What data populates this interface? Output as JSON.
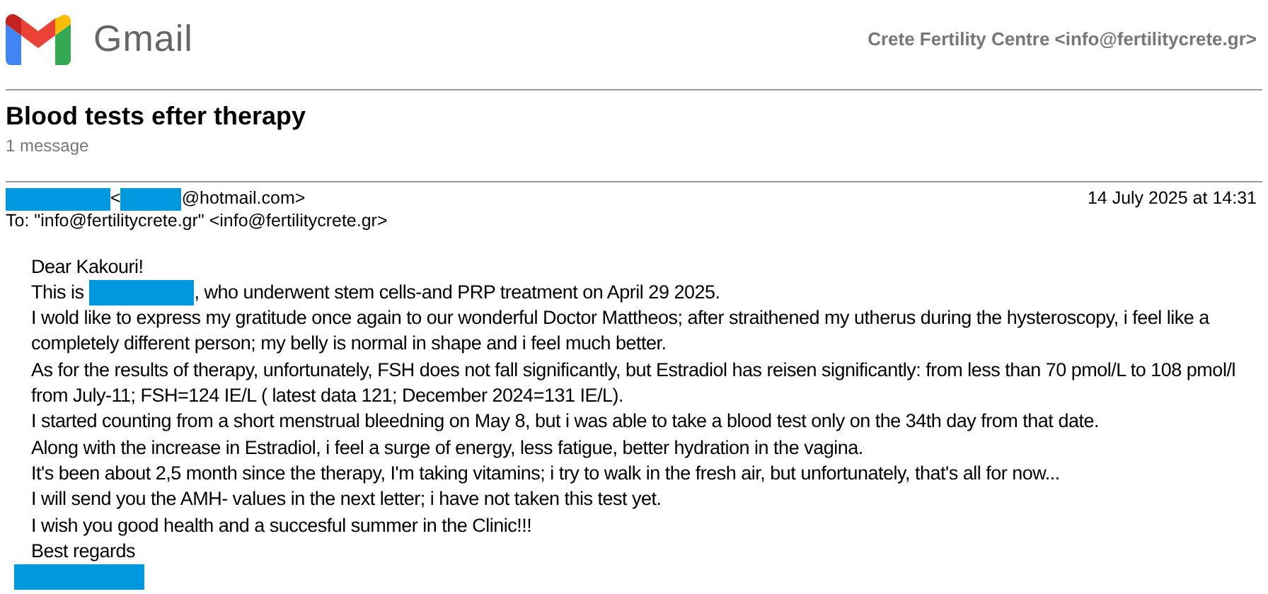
{
  "header": {
    "app_name": "Gmail",
    "account": "Crete Fertility Centre <info@fertilitycrete.gr>"
  },
  "thread": {
    "subject": "Blood tests efter therapy",
    "count": "1 message"
  },
  "message": {
    "from": [
      {
        "kind": "redacted"
      },
      {
        "kind": "text",
        "text": "<"
      },
      {
        "kind": "redacted"
      },
      {
        "kind": "text",
        "text": "@hotmail.com>"
      }
    ],
    "date": "14 July 2025 at 14:31",
    "to": "To: \"info@fertilitycrete.gr\" <info@fertilitycrete.gr>",
    "body": [
      [
        {
          "kind": "text",
          "text": "Dear Kakouri!"
        }
      ],
      [
        {
          "kind": "text",
          "text": "This is"
        },
        {
          "kind": "redacted"
        },
        {
          "kind": "text",
          "text": ", who underwent stem cells-and PRP treatment on April 29 2025."
        }
      ],
      [
        {
          "kind": "text",
          "text": "I wold like to express my gratitude once again to our wonderful Doctor Mattheos; after straithened my utherus during the hysteroscopy, i feel like a completely different person; my belly is normal in shape and i feel much better."
        }
      ],
      [
        {
          "kind": "text",
          "text": "As for the results of therapy, unfortunately, FSH does not fall significantly, but Estradiol has reisen significantly: from less than 70 pmol/L to 108 pmol/l from July-11; FSH=124 IE/L ( latest data 121; December 2024=131 IE/L)."
        }
      ],
      [
        {
          "kind": "text",
          "text": "I started counting from a short menstrual bleedning on May 8, but i was able to take a blood test only on the 34th day from that date."
        }
      ],
      [
        {
          "kind": "text",
          "text": "Along with the increase in Estradiol, i feel a surge of energy, less fatigue, better hydration in the vagina."
        }
      ],
      [
        {
          "kind": "text",
          "text": "It's been about 2,5 month since the therapy, I'm taking vitamins; i try to walk in the fresh air, but unfortunately, that's all for now..."
        }
      ],
      [
        {
          "kind": "text",
          "text": "I will send you the AMH- values in the next letter; i have not taken this test yet."
        }
      ],
      [
        {
          "kind": "text",
          "text": "I wish you good health and a succesful summer in the Clinic!!!"
        }
      ],
      [
        {
          "kind": "text",
          "text": "Best regards"
        }
      ],
      [
        {
          "kind": "redacted"
        }
      ]
    ]
  }
}
